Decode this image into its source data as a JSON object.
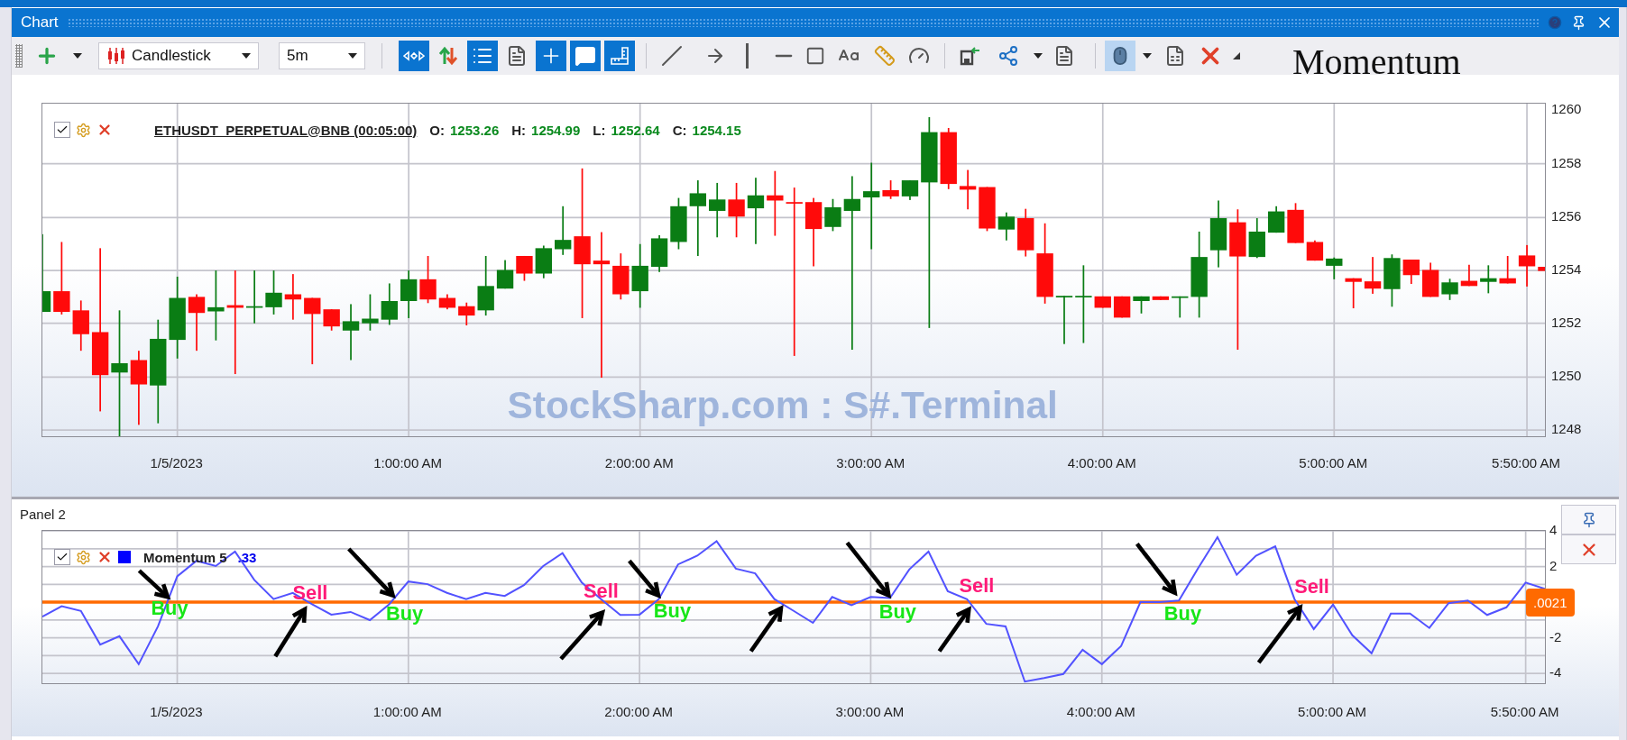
{
  "window": {
    "title": "Chart"
  },
  "toolbar": {
    "chart_type": "Candlestick",
    "timeframe": "5m",
    "toggles": [
      {
        "selected": true
      },
      {
        "selected": false
      },
      {
        "selected": true
      },
      {
        "selected": false
      },
      {
        "selected": true
      },
      {
        "selected": true
      },
      {
        "selected": true
      }
    ],
    "mouse_button": {
      "selected": true
    }
  },
  "overlay_title": "Momentum",
  "price_panel": {
    "legend": {
      "checked": true,
      "symbol": "ETHUSDT_PERPETUAL@BNB (00:05:00)",
      "ohlc": [
        {
          "label": "O:",
          "value": "1253.26"
        },
        {
          "label": "H:",
          "value": "1254.99"
        },
        {
          "label": "L:",
          "value": "1252.64"
        },
        {
          "label": "C:",
          "value": "1254.15"
        }
      ]
    },
    "background_text": "StockSharp.com : S#.Terminal",
    "y_labels": [
      "1260",
      "1258",
      "1256",
      "1254",
      "1252",
      "1250",
      "1248"
    ],
    "x_labels": [
      "1/5/2023",
      "1:00:00 AM",
      "2:00:00 AM",
      "3:00:00 AM",
      "4:00:00 AM",
      "5:00:00 AM",
      "5:50:00 AM"
    ]
  },
  "indicator_panel": {
    "title": "Panel 2",
    "legend": {
      "checked": true,
      "value": ".33",
      "color": "#0000ff"
    },
    "level_label": ".0021",
    "signals": [
      {
        "text": "Buy",
        "kind": "buy"
      },
      {
        "text": "Sell",
        "kind": "sell"
      },
      {
        "text": "Buy",
        "kind": "buy"
      },
      {
        "text": "Sell",
        "kind": "sell"
      },
      {
        "text": "Buy",
        "kind": "buy"
      },
      {
        "text": "Buy",
        "kind": "buy"
      },
      {
        "text": "Sell",
        "kind": "sell"
      },
      {
        "text": "Buy",
        "kind": "buy"
      },
      {
        "text": "Sell",
        "kind": "sell"
      }
    ],
    "x_labels": [
      "1/5/2023",
      "1:00:00 AM",
      "2:00:00 AM",
      "3:00:00 AM",
      "4:00:00 AM",
      "5:00:00 AM",
      "5:50:00 AM"
    ],
    "chart_data": {
      "type": "line",
      "ylim": [
        -4.55,
        4
      ],
      "grid": true,
      "ref_lines": [
        {
          "axis": "y",
          "value": 0,
          "color": "#ff6a00"
        }
      ],
      "yticks": [
        {
          "value": 4,
          "label": "4"
        },
        {
          "value": 2,
          "label": "2"
        },
        {
          "value": -2,
          "label": "-2"
        },
        {
          "value": -4,
          "label": "-4"
        }
      ],
      "series": [
        {
          "name": "Momentum 5",
          "color": "#5252ff",
          "values": [
            -0.81,
            -0.23,
            -0.49,
            -2.38,
            -1.91,
            -3.48,
            -1.36,
            1.45,
            2.32,
            2.03,
            2.84,
            1.25,
            0.17,
            0.52,
            -0.12,
            -0.7,
            -0.55,
            -1.01,
            -0.12,
            1.16,
            1.01,
            0.52,
            0.17,
            0.52,
            0.35,
            0.96,
            2.03,
            2.75,
            1.1,
            0.17,
            -0.72,
            -0.7,
            0.17,
            2.12,
            2.61,
            3.42,
            1.88,
            1.62,
            0.17,
            -0.49,
            -1.16,
            0.29,
            -0.17,
            0.29,
            0.23,
            1.83,
            2.84,
            0.61,
            0.17,
            -1.22,
            -1.36,
            -4.46,
            -4.26,
            -4.03,
            -2.67,
            -3.48,
            -2.46,
            0,
            0,
            0.09,
            1.91,
            3.65,
            1.54,
            2.61,
            3.13,
            0.17,
            -1.51,
            -0.14,
            -1.86,
            -2.87,
            -0.64,
            -0.64,
            -1.45,
            -0.06,
            0.09,
            -0.72,
            -0.29,
            1.1,
            0.75
          ]
        }
      ]
    }
  }
}
